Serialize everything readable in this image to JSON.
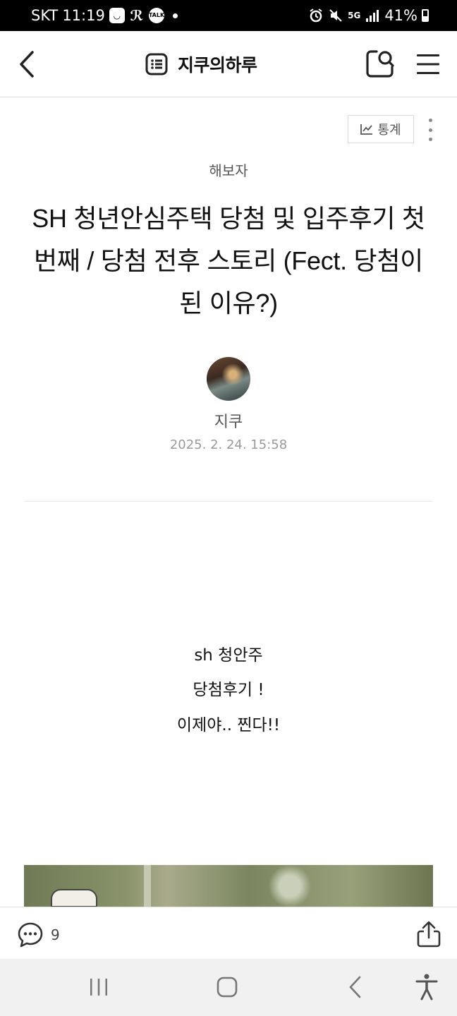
{
  "status_bar": {
    "carrier": "SKT",
    "time": "11:19",
    "network": "5G",
    "battery": "41%",
    "app_icons": [
      "smile-icon",
      "r-icon",
      "talk-icon"
    ]
  },
  "header": {
    "title": "지쿠의하루",
    "icons": [
      "back-icon",
      "list-icon",
      "search-icon",
      "menu-icon"
    ]
  },
  "post": {
    "stats_label": "통계",
    "category": "해보자",
    "title": "SH 청년안심주택 당첨 및 입주후기 첫번째 / 당첨 전후 스토리 (Fect. 당첨이된 이유?)",
    "author": "지쿠",
    "date": "2025. 2. 24. 15:58",
    "body_lines": [
      "sh 청안주",
      "당첨후기 !",
      "이제야.. 찐다!!"
    ]
  },
  "bottom_bar": {
    "comment_count": "9"
  }
}
